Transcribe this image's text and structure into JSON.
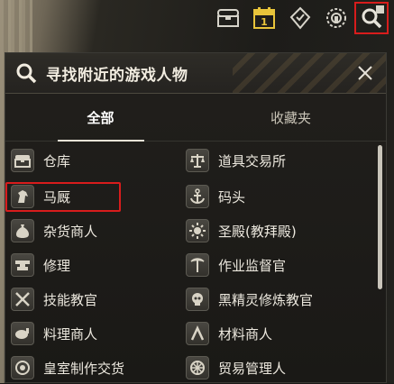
{
  "hud": {
    "icons": [
      "chest-icon",
      "calendar-icon",
      "map-pin-icon",
      "badge-icon",
      "search-icon"
    ]
  },
  "panel": {
    "title": "寻找附近的游戏人物",
    "tabs": [
      {
        "label": "全部",
        "active": true
      },
      {
        "label": "收藏夹",
        "active": false
      }
    ],
    "items_left": [
      {
        "label": "仓库",
        "icon": "chest-icon"
      },
      {
        "label": "马厩",
        "icon": "horse-icon"
      },
      {
        "label": "杂货商人",
        "icon": "sack-icon"
      },
      {
        "label": "修理",
        "icon": "anvil-icon"
      },
      {
        "label": "技能教官",
        "icon": "crossed-swords-icon"
      },
      {
        "label": "料理商人",
        "icon": "chicken-icon"
      },
      {
        "label": "皇室制作交货",
        "icon": "crest-icon"
      }
    ],
    "items_right": [
      {
        "label": "道具交易所",
        "icon": "scales-icon"
      },
      {
        "label": "码头",
        "icon": "anchor-icon"
      },
      {
        "label": "圣殿(教拜殿)",
        "icon": "sun-icon"
      },
      {
        "label": "作业监督官",
        "icon": "pickaxe-icon"
      },
      {
        "label": "黑精灵修炼教官",
        "icon": "skull-icon"
      },
      {
        "label": "材料商人",
        "icon": "hook-icon"
      },
      {
        "label": "贸易管理人",
        "icon": "wheel-icon"
      }
    ]
  },
  "colors": {
    "highlight": "#d81c1c",
    "calendar": "#e8c43a"
  }
}
